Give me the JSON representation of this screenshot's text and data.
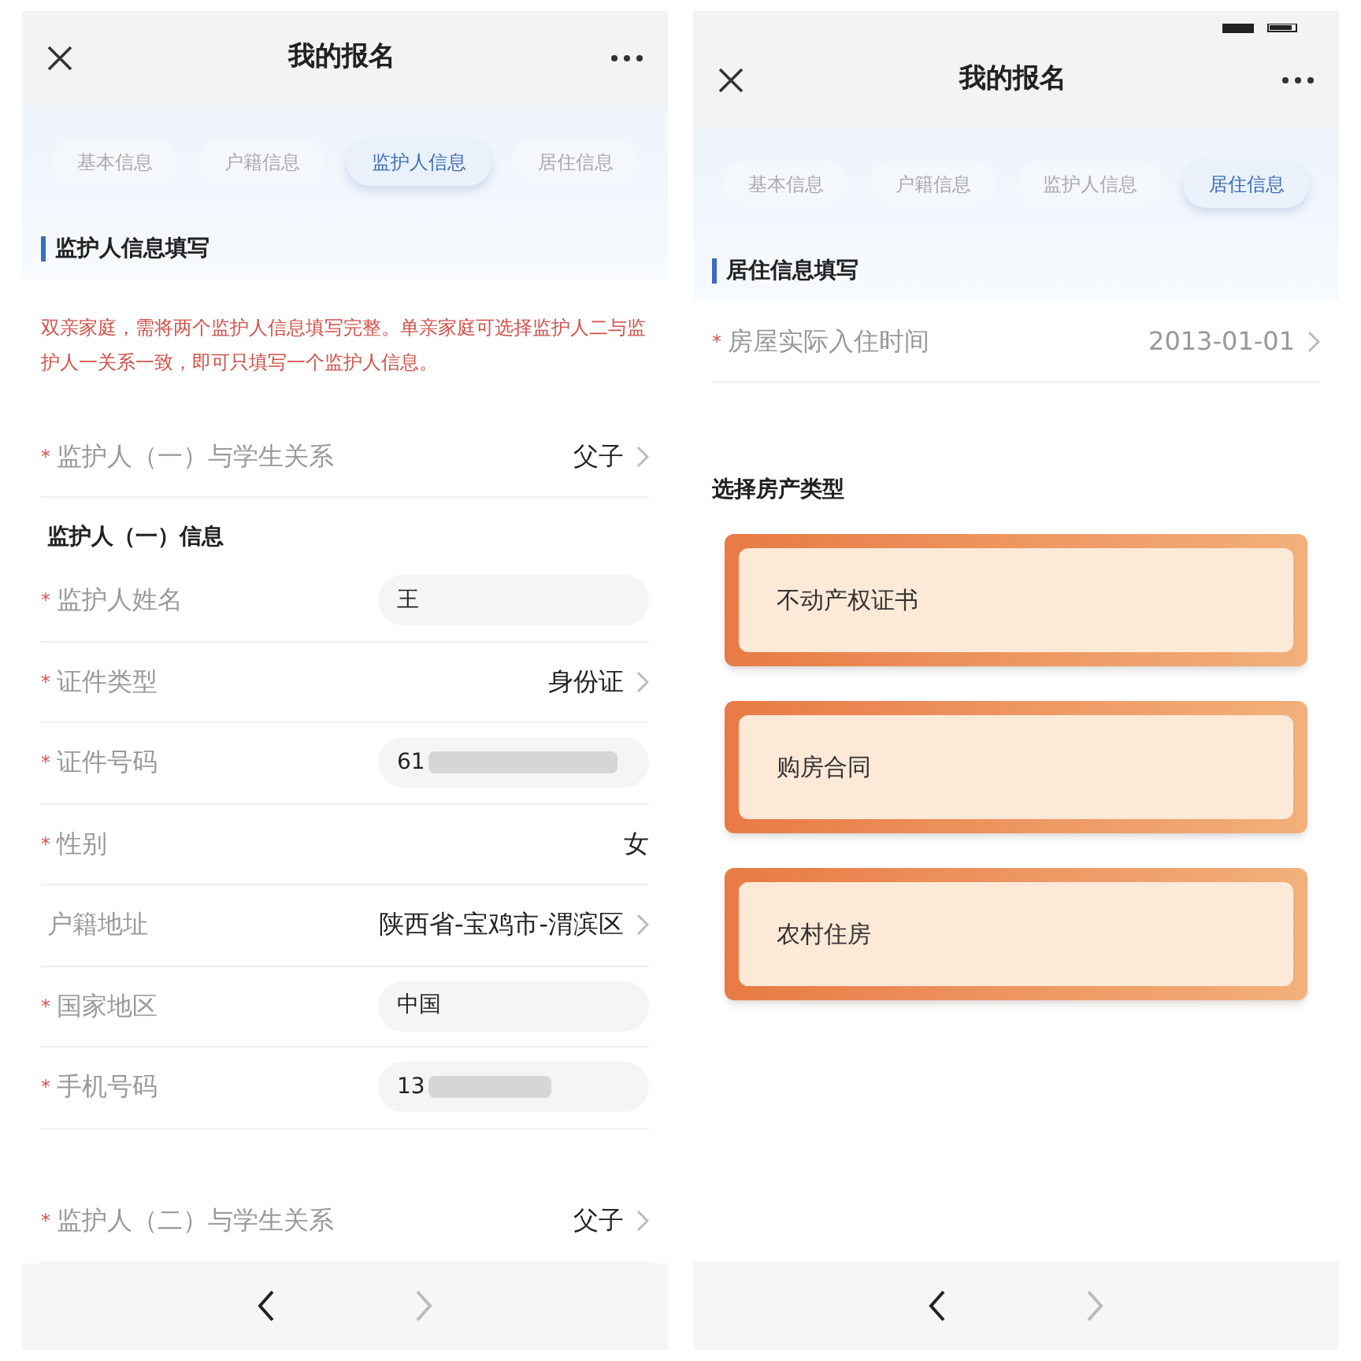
{
  "screens": [
    {
      "title": "我的报名",
      "tabs": [
        {
          "label": "基本信息",
          "selected": false
        },
        {
          "label": "户籍信息",
          "selected": false
        },
        {
          "label": "监护人信息",
          "selected": true
        },
        {
          "label": "居住信息",
          "selected": false
        }
      ],
      "section_title": "监护人信息填写",
      "notice": "双亲家庭，需将两个监护人信息填写完整。单亲家庭可选择监护人二与监护人一关系一致，即可只填写一个监护人信息。",
      "rows": [
        {
          "kind": "select",
          "marker": "*",
          "label": "监护人（一）与学生关系",
          "value": "父子"
        },
        {
          "kind": "subheading",
          "label": "监护人（一）信息"
        },
        {
          "kind": "input",
          "marker": "*",
          "label": "监护人姓名",
          "value": "王"
        },
        {
          "kind": "select",
          "marker": "*",
          "label": "证件类型",
          "value": "身份证"
        },
        {
          "kind": "input",
          "marker": "*",
          "label": "证件号码",
          "value": "61",
          "blurred": true
        },
        {
          "kind": "text",
          "marker": "*",
          "label": "性别",
          "value": "女"
        },
        {
          "kind": "select",
          "label": "户籍地址",
          "value": "陕西省-宝鸡市-渭滨区"
        },
        {
          "kind": "input",
          "marker": "*",
          "label": "国家地区",
          "value": "中国"
        },
        {
          "kind": "input",
          "marker": "*",
          "label": "手机号码",
          "value": "13",
          "blurred": true
        },
        {
          "kind": "spacer"
        },
        {
          "kind": "select",
          "marker": "*",
          "label": "监护人（二）与学生关系",
          "value": "父子"
        }
      ],
      "bottom_nav": {
        "back_enabled": true,
        "forward_enabled": false
      }
    },
    {
      "status_bar": true,
      "title": "我的报名",
      "tabs": [
        {
          "label": "基本信息",
          "selected": false
        },
        {
          "label": "户籍信息",
          "selected": false
        },
        {
          "label": "监护人信息",
          "selected": false
        },
        {
          "label": "居住信息",
          "selected": true
        }
      ],
      "section_title": "居住信息填写",
      "rows": [
        {
          "kind": "select",
          "marker": "*",
          "label": "房屋实际入住时间",
          "value": "2013-01-01",
          "muted": true
        }
      ],
      "property_title": "选择房产类型",
      "property_options": [
        "不动产权证书",
        "购房合同",
        "农村住房"
      ],
      "bottom_nav": {
        "back_enabled": true,
        "forward_enabled": false
      }
    }
  ]
}
